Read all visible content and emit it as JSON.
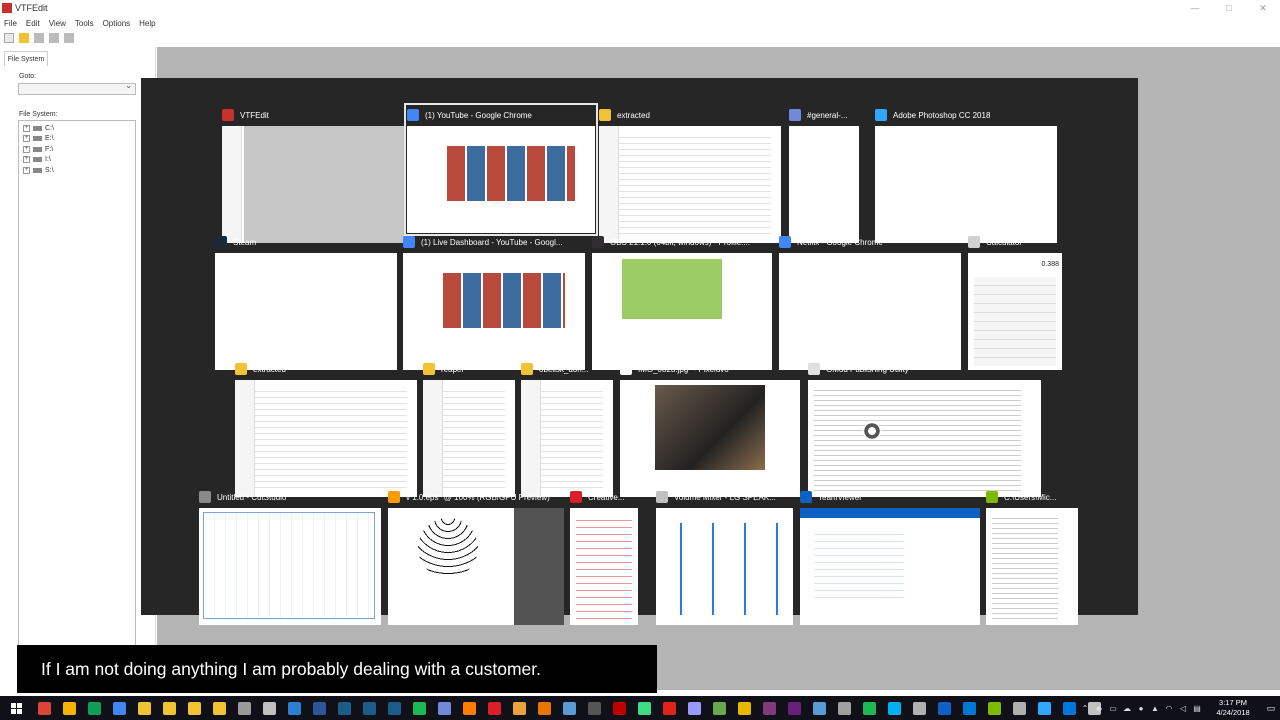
{
  "app": {
    "title": "VTFEdit",
    "menu": [
      "File",
      "Edit",
      "View",
      "Tools",
      "Options",
      "Help"
    ],
    "window_controls": [
      "—",
      "□",
      "✕"
    ],
    "tab": "File System",
    "goto_label": "Goto:",
    "fs_label": "File System:",
    "drives": [
      "C:\\",
      "E:\\",
      "F:\\",
      "I:\\",
      "S:\\"
    ]
  },
  "task_view": {
    "windows": [
      {
        "title": "VTFEdit",
        "icon": "vtfedit-icon",
        "icon_color": "#c8302c",
        "thumb": "t-vtf t-explorer"
      },
      {
        "title": "(1) YouTube - Google Chrome",
        "icon": "chrome-icon",
        "icon_color": "#4285f4",
        "thumb": "t-ytgrid",
        "selected": true
      },
      {
        "title": "extracted",
        "icon": "folder-icon",
        "icon_color": "#f1c232",
        "thumb": "t-explorer"
      },
      {
        "title": "#general-...",
        "icon": "discord-icon",
        "icon_color": "#7289da",
        "thumb": "t-discord"
      },
      {
        "title": "Adobe Photoshop CC 2018",
        "icon": "photoshop-icon",
        "icon_color": "#31a8ff",
        "thumb": "t-ps"
      },
      {
        "title": "Steam",
        "icon": "steam-icon",
        "icon_color": "#1b2838",
        "thumb": "t-steam"
      },
      {
        "title": "(1) Live Dashboard - YouTube - Googl...",
        "icon": "chrome-icon",
        "icon_color": "#4285f4",
        "thumb": "t-ytgrid"
      },
      {
        "title": "OBS 21.1.0 (64bit, windows) - Profile:...",
        "icon": "obs-icon",
        "icon_color": "#302e31",
        "thumb": "t-obs"
      },
      {
        "title": "Netflix - Google Chrome",
        "icon": "chrome-icon",
        "icon_color": "#4285f4",
        "thumb": "t-netflix"
      },
      {
        "title": "Calculator",
        "icon": "calculator-icon",
        "icon_color": "#d0d0d0",
        "thumb": "t-calc",
        "display": "0.388"
      },
      {
        "title": "extracted",
        "icon": "folder-icon",
        "icon_color": "#f1c232",
        "thumb": "t-explorer"
      },
      {
        "title": "reaper",
        "icon": "folder-icon",
        "icon_color": "#f1c232",
        "thumb": "t-explorer"
      },
      {
        "title": "obelisk_don...",
        "icon": "folder-icon",
        "icon_color": "#f1c232",
        "thumb": "t-explorer"
      },
      {
        "title": "IMG_0823.jpg* - Pixeluvo",
        "icon": "pixeluvo-icon",
        "icon_color": "#ffffff",
        "thumb": "t-pixeluvo"
      },
      {
        "title": "GMod Publishing Utility",
        "icon": "gmod-icon",
        "icon_color": "#e0e0e0",
        "thumb": "t-gmod t-code"
      },
      {
        "title": "Untitled - CutStudio",
        "icon": "cutstudio-icon",
        "icon_color": "#8a8a8a",
        "thumb": "t-cutstudio"
      },
      {
        "title": "v 1.0.eps* @ 100% (RGB/GPU Preview)",
        "icon": "illustrator-icon",
        "icon_color": "#ff9a00",
        "thumb": "t-ai"
      },
      {
        "title": "Creative...",
        "icon": "creative-cloud-icon",
        "icon_color": "#da1f26",
        "thumb": "t-creative"
      },
      {
        "title": "Volume Mixer - LG SPEAK...",
        "icon": "speaker-icon",
        "icon_color": "#c0c0c0",
        "thumb": "t-mixer"
      },
      {
        "title": "TeamViewer",
        "icon": "teamviewer-icon",
        "icon_color": "#0e61c3",
        "thumb": "t-teamviewer"
      },
      {
        "title": "C:\\Users\\Mic...",
        "icon": "notepad-icon",
        "icon_color": "#7fba00",
        "thumb": "t-code"
      }
    ]
  },
  "subtitle": "If I am not doing anything I am probably dealing with a customer.",
  "taskbar": {
    "apps": [
      {
        "name": "chrome-icon",
        "color": "#db4437"
      },
      {
        "name": "chrome-icon",
        "color": "#f4b400"
      },
      {
        "name": "chrome-icon",
        "color": "#0f9d58"
      },
      {
        "name": "chrome-icon",
        "color": "#4285f4"
      },
      {
        "name": "folder-icon",
        "color": "#f1c232"
      },
      {
        "name": "folder-icon",
        "color": "#f1c232"
      },
      {
        "name": "folder-icon",
        "color": "#f1c232"
      },
      {
        "name": "folder-icon",
        "color": "#f1c232"
      },
      {
        "name": "vtfedit-icon",
        "color": "#9a9a9a"
      },
      {
        "name": "gear-icon",
        "color": "#c0c0c0"
      },
      {
        "name": "monitor-icon",
        "color": "#2d7dd2"
      },
      {
        "name": "word-icon",
        "color": "#2b579a"
      },
      {
        "name": "steam-icon",
        "color": "#1b5c8a"
      },
      {
        "name": "steam-icon",
        "color": "#1b5c8a"
      },
      {
        "name": "steam-icon",
        "color": "#1b5c8a"
      },
      {
        "name": "spotify-icon",
        "color": "#1db954"
      },
      {
        "name": "discord-icon",
        "color": "#7289da"
      },
      {
        "name": "illustrator-icon",
        "color": "#ff7c00"
      },
      {
        "name": "creative-cloud-icon",
        "color": "#da1f26"
      },
      {
        "name": "lock-icon",
        "color": "#e8a33d"
      },
      {
        "name": "blender-icon",
        "color": "#ea7600"
      },
      {
        "name": "image-icon",
        "color": "#5b9bd5"
      },
      {
        "name": "obs-icon",
        "color": "#555555"
      },
      {
        "name": "filezilla-icon",
        "color": "#bf0000"
      },
      {
        "name": "android-studio-icon",
        "color": "#3ddc84"
      },
      {
        "name": "acrobat-icon",
        "color": "#e2231a"
      },
      {
        "name": "premiere-icon",
        "color": "#9999ff"
      },
      {
        "name": "reaper-icon",
        "color": "#6aa84f"
      },
      {
        "name": "winamp-icon",
        "color": "#e6b800"
      },
      {
        "name": "onenote-icon",
        "color": "#80397b"
      },
      {
        "name": "visual-studio-icon",
        "color": "#68217a"
      },
      {
        "name": "network-icon",
        "color": "#5b9bd5"
      },
      {
        "name": "gamepad-icon",
        "color": "#a0a0a0"
      },
      {
        "name": "shield-icon",
        "color": "#1db954"
      },
      {
        "name": "skype-icon",
        "color": "#00aff0"
      },
      {
        "name": "globe-icon",
        "color": "#b0b0b0"
      },
      {
        "name": "teamviewer-icon",
        "color": "#0e61c3"
      },
      {
        "name": "mail-icon",
        "color": "#0078d7"
      },
      {
        "name": "notepad-icon",
        "color": "#7fba00"
      },
      {
        "name": "image-icon",
        "color": "#b0b0b0"
      },
      {
        "name": "photoshop-icon",
        "color": "#31a8ff"
      },
      {
        "name": "pen-icon",
        "color": "#0078d7"
      },
      {
        "name": "calculator-icon",
        "color": "#c0c0c0"
      }
    ],
    "clock_time": "3:17 PM",
    "clock_date": "4/24/2018"
  }
}
